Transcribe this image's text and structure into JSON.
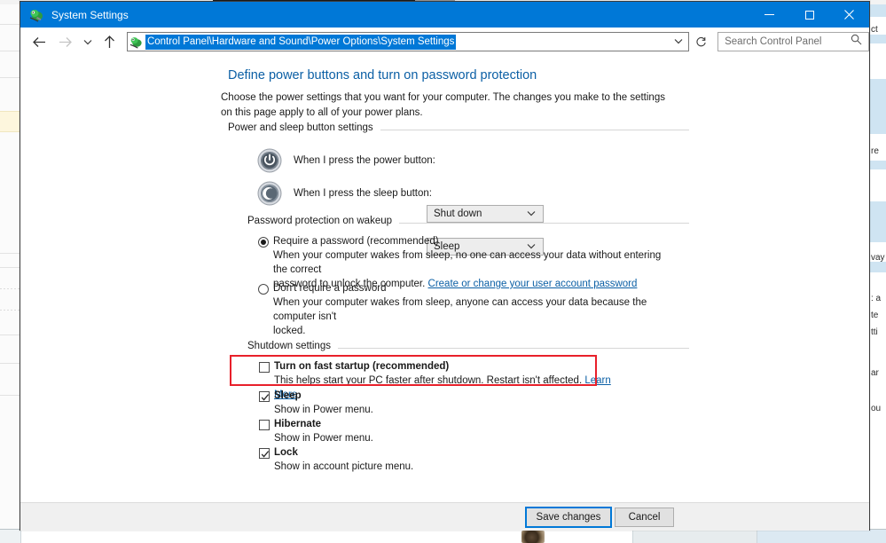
{
  "window": {
    "title": "System Settings",
    "icon": "power-options-icon",
    "controls": {
      "minimize": "minimize-button",
      "maximize": "maximize-button",
      "close": "close-button"
    }
  },
  "nav": {
    "back": "back-arrow-icon",
    "forward": "forward-arrow-icon",
    "history": "recent-locations-chevron",
    "up": "up-arrow-icon",
    "address_path": "Control Panel\\Hardware and Sound\\Power Options\\System Settings",
    "address_chevron": "address-dropdown-chevron",
    "refresh": "refresh-icon"
  },
  "search": {
    "placeholder": "Search Control Panel",
    "icon": "search-icon"
  },
  "page": {
    "title": "Define power buttons and turn on password protection",
    "description": "Choose the power settings that you want for your computer. The changes you make to the settings on this page apply to all of your power plans."
  },
  "groups": {
    "power_sleep": {
      "label": "Power and sleep button settings",
      "rows": [
        {
          "icon": "power-button-icon",
          "label": "When I press the power button:",
          "value": "Shut down"
        },
        {
          "icon": "sleep-moon-icon",
          "label": "When I press the sleep button:",
          "value": "Sleep"
        }
      ]
    },
    "password": {
      "label": "Password protection on wakeup",
      "options": [
        {
          "label": "Require a password (recommended)",
          "checked": true,
          "desc_a": "When your computer wakes from sleep, no one can access your data without entering the correct",
          "desc_b": "password to unlock the computer.",
          "link": "Create or change your user account password"
        },
        {
          "label": "Don't require a password",
          "checked": false,
          "desc_a": "When your computer wakes from sleep, anyone can access your data because the computer isn't",
          "desc_b": "locked.",
          "link": ""
        }
      ]
    },
    "shutdown": {
      "label": "Shutdown settings",
      "items": [
        {
          "label": "Turn on fast startup (recommended)",
          "checked": false,
          "desc": "This helps start your PC faster after shutdown. Restart isn't affected.",
          "link": "Learn More",
          "highlighted": true
        },
        {
          "label": "Sleep",
          "checked": true,
          "desc": "Show in Power menu.",
          "link": "",
          "highlighted": false
        },
        {
          "label": "Hibernate",
          "checked": false,
          "desc": "Show in Power menu.",
          "link": "",
          "highlighted": false
        },
        {
          "label": "Lock",
          "checked": true,
          "desc": "Show in account picture menu.",
          "link": "",
          "highlighted": false
        }
      ]
    }
  },
  "footer": {
    "save_label": "Save changes",
    "cancel_label": "Cancel"
  },
  "background": {
    "right_fragments": [
      "ct",
      "re",
      "vay",
      ": a",
      "te",
      "tti",
      "ar",
      "ou"
    ]
  },
  "colors": {
    "accent": "#0078d7",
    "title_link": "#0b5fa5",
    "highlight_red": "#e8202a",
    "selection_blue": "#0078d7"
  }
}
